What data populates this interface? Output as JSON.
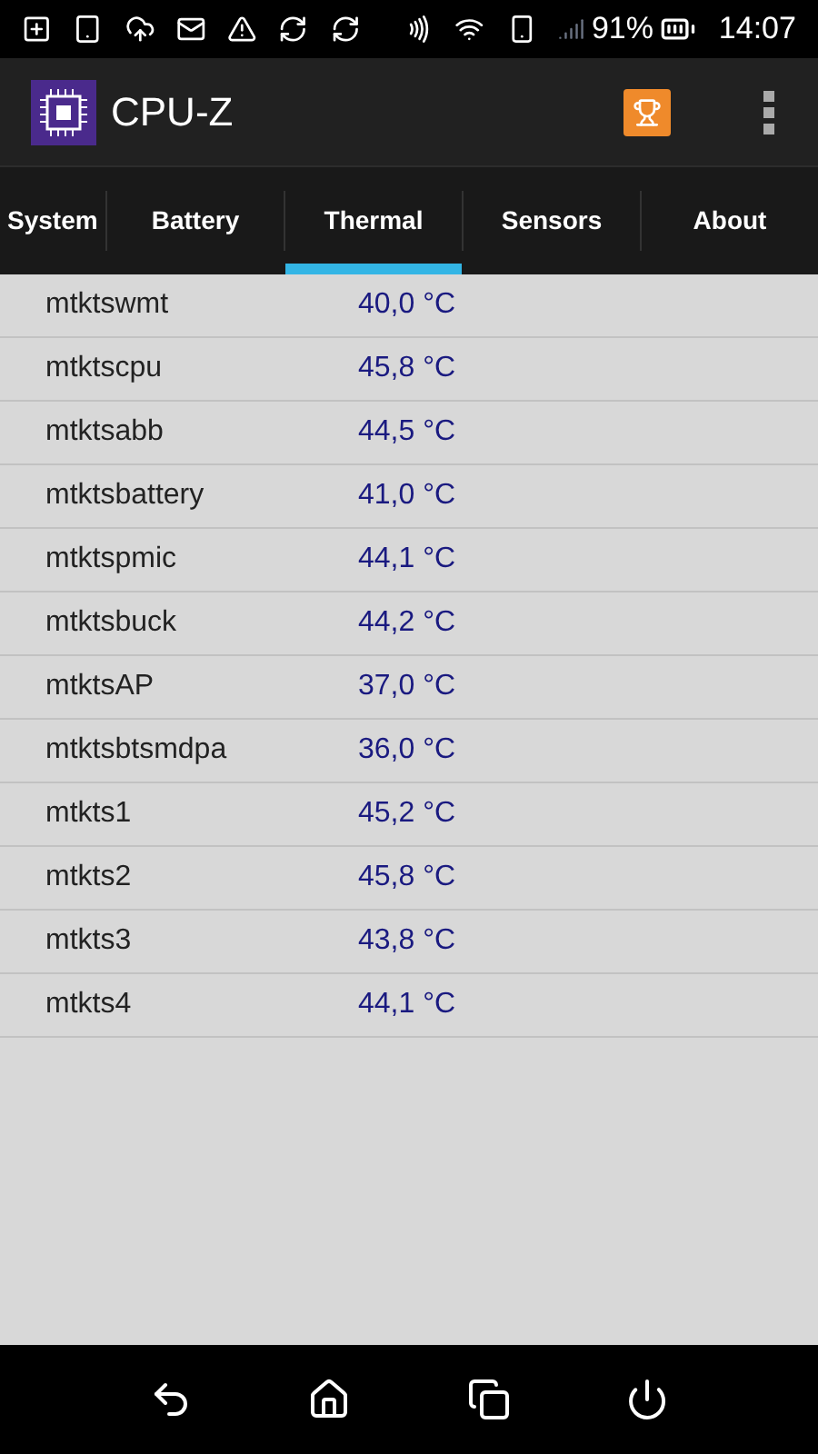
{
  "status_bar": {
    "battery": "91%",
    "time": "14:07"
  },
  "app_bar": {
    "title": "CPU-Z"
  },
  "tabs": [
    {
      "label": "System",
      "selected": false
    },
    {
      "label": "Battery",
      "selected": false
    },
    {
      "label": "Thermal",
      "selected": true
    },
    {
      "label": "Sensors",
      "selected": false
    },
    {
      "label": "About",
      "selected": false
    }
  ],
  "rows": [
    {
      "name": "mtktswmt",
      "value": "40,0 °C"
    },
    {
      "name": "mtktscpu",
      "value": "45,8 °C"
    },
    {
      "name": "mtktsabb",
      "value": "44,5 °C"
    },
    {
      "name": "mtktsbattery",
      "value": "41,0 °C"
    },
    {
      "name": "mtktspmic",
      "value": "44,1 °C"
    },
    {
      "name": "mtktsbuck",
      "value": "44,2 °C"
    },
    {
      "name": "mtktsAP",
      "value": "37,0 °C"
    },
    {
      "name": "mtktsbtsmdpa",
      "value": "36,0 °C"
    },
    {
      "name": "mtkts1",
      "value": "45,2 °C"
    },
    {
      "name": "mtkts2",
      "value": "45,8 °C"
    },
    {
      "name": "mtkts3",
      "value": "43,8 °C"
    },
    {
      "name": "mtkts4",
      "value": "44,1 °C"
    }
  ]
}
